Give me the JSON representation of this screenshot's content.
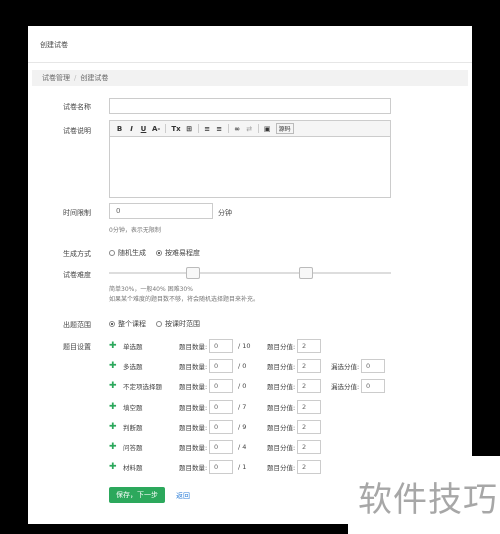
{
  "header": {
    "title": "创建试卷"
  },
  "breadcrumb": {
    "items": [
      "试卷管理",
      "创建试卷"
    ]
  },
  "form": {
    "name_label": "试卷名称",
    "name_value": "",
    "desc_label": "试卷说明",
    "editor_toolbar": [
      "B",
      "I",
      "U",
      "A-",
      "Tx",
      "⊞",
      "≡",
      "≡",
      "∞",
      "⇄",
      "▣",
      "源码"
    ],
    "time_label": "时间限制",
    "time_value": "0",
    "time_unit": "分钟",
    "time_hint": "0分钟，表示无限制",
    "mode_label": "生成方式",
    "mode_options": [
      {
        "label": "随机生成",
        "checked": false
      },
      {
        "label": "按难易程度",
        "checked": true
      }
    ],
    "difficulty_label": "试卷难度",
    "difficulty_summary": "简单30%，一般40% 困难30%",
    "difficulty_hint": "如果某个难度的题目数不够，将会随机选择题目来补充。",
    "scope_label": "出题范围",
    "scope_options": [
      {
        "label": "整个课程",
        "checked": true
      },
      {
        "label": "按课时范围",
        "checked": false
      }
    ],
    "questions_label": "题目设置",
    "count_label": "题目数量:",
    "score_label": "题目分值:",
    "partial_label": "漏选分值:",
    "questions": [
      {
        "name": "单选题",
        "count": "0",
        "total": "/ 10",
        "score": "2"
      },
      {
        "name": "多选题",
        "count": "0",
        "total": "/ 0",
        "score": "2",
        "partial": "0"
      },
      {
        "name": "不定项选择题",
        "count": "0",
        "total": "/ 0",
        "score": "2",
        "partial": "0"
      },
      {
        "name": "填空题",
        "count": "0",
        "total": "/ 7",
        "score": "2"
      },
      {
        "name": "判断题",
        "count": "0",
        "total": "/ 9",
        "score": "2"
      },
      {
        "name": "问答题",
        "count": "0",
        "total": "/ 4",
        "score": "2"
      },
      {
        "name": "材料题",
        "count": "0",
        "total": "/ 1",
        "score": "2"
      }
    ],
    "save_button": "保存，下一步",
    "back_link": "返回"
  },
  "watermark": {
    "text": "软件技巧"
  },
  "colors": {
    "primary": "#2ca85c",
    "link": "#2b7dd8",
    "background": "#000000"
  }
}
